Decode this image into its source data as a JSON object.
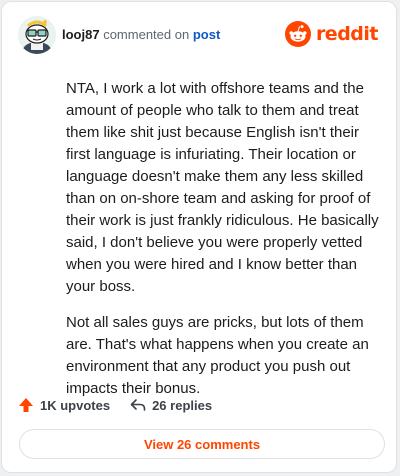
{
  "comment": {
    "username": "looj87",
    "commented_on_text": "commented on",
    "post_link": "post",
    "paragraphs": [
      "NTA, I work a lot with offshore teams and the amount of people who talk to them and treat them like shit just because English isn't their first language is infuriating. Their location or language doesn't make them any less skilled than on on-shore team and asking for proof of their work is just frankly ridiculous. He basically said, I don't believe you were properly vetted when you were hired and I know better than your boss.",
      "Not all sales guys are pricks, but lots of them are. That's what happens when you create an environment that any product you push out impacts their bonus."
    ]
  },
  "brand": {
    "name": "reddit",
    "color": "#ff4500"
  },
  "stats": {
    "upvotes": "1K upvotes",
    "replies": "26 replies"
  },
  "footer": {
    "view_comments": "View 26 comments"
  },
  "icons": {
    "avatar": "snoo-avatar",
    "logo": "reddit-snoo-icon",
    "upvote": "upvote-arrow-icon",
    "reply": "reply-arrow-icon"
  }
}
